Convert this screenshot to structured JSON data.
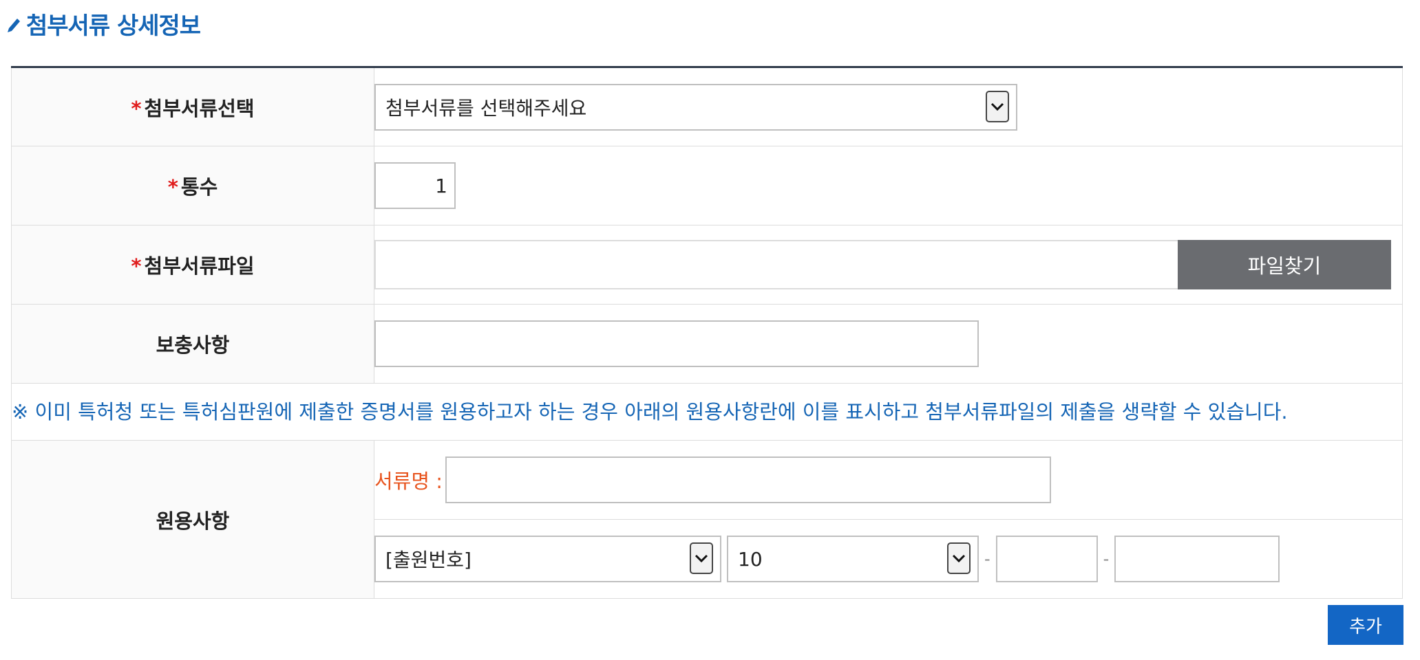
{
  "section": {
    "title": "첨부서류 상세정보"
  },
  "form": {
    "doc_select": {
      "label": "첨부서류선택",
      "required_mark": "*",
      "value": "첨부서류를 선택해주세요"
    },
    "copies": {
      "label": "통수",
      "required_mark": "*",
      "value": "1"
    },
    "doc_file": {
      "label": "첨부서류파일",
      "required_mark": "*",
      "button_label": "파일찾기"
    },
    "supplement": {
      "label": "보충사항",
      "value": ""
    },
    "notice": "※ 이미 특허청 또는 특허심판원에 제출한 증명서를 원용하고자 하는 경우 아래의 원용사항란에 이를 표시하고 첨부서류파일의 제출을 생략할 수 있습니다.",
    "citation": {
      "label": "원용사항",
      "doc_name_label": "서류명 :",
      "number_type": "[출원번호]",
      "number_code": "10",
      "separator": "-"
    }
  },
  "actions": {
    "add_label": "추가"
  },
  "colors": {
    "accent": "#1565b5",
    "required": "#e01c1c",
    "doc_label": "#e8541e",
    "file_button": "#6a6c70",
    "add_button": "#1366c5"
  }
}
